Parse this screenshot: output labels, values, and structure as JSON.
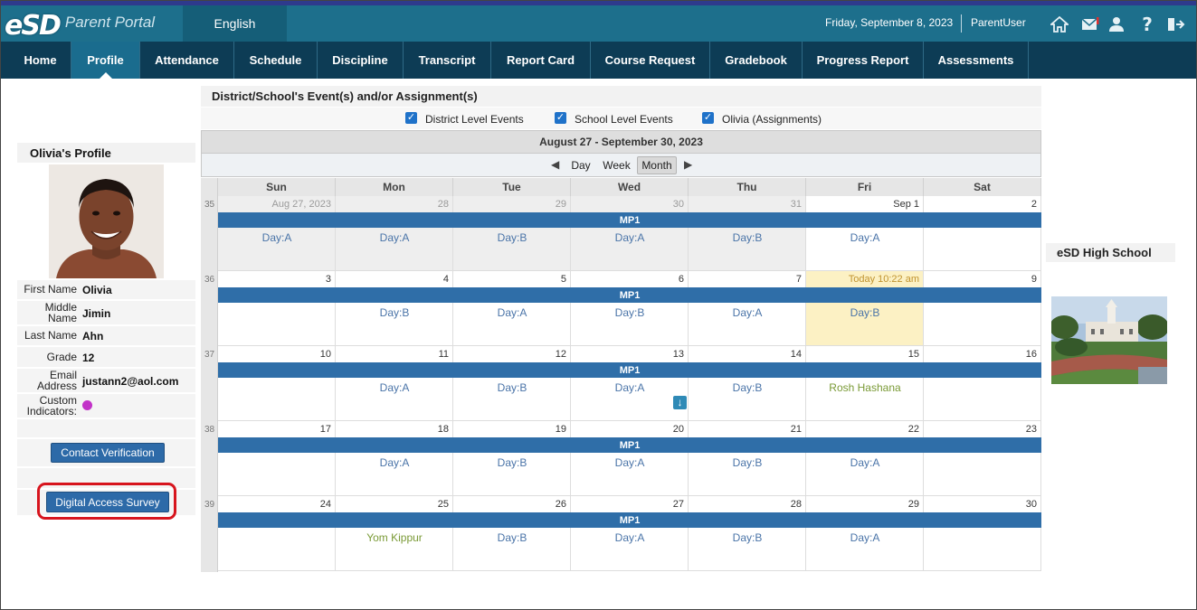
{
  "header": {
    "logo_mark": "eSD",
    "logo_text": "Parent Portal",
    "language": "English",
    "date": "Friday, September 8, 2023",
    "user": "ParentUser",
    "icons": [
      "home-icon",
      "mail-icon",
      "user-icon",
      "help-icon",
      "logout-icon"
    ]
  },
  "nav": {
    "items": [
      "Home",
      "Profile",
      "Attendance",
      "Schedule",
      "Discipline",
      "Transcript",
      "Report Card",
      "Course Request",
      "Gradebook",
      "Progress Report",
      "Assessments"
    ],
    "active": "Profile"
  },
  "profile": {
    "title": "Olivia's Profile",
    "first_name_label": "First Name",
    "first_name": "Olivia",
    "middle_name_label_1": "Middle",
    "middle_name_label_2": "Name",
    "middle_name": "Jimin",
    "last_name_label": "Last Name",
    "last_name": "Ahn",
    "grade_label": "Grade",
    "grade": "12",
    "email_label_1": "Email",
    "email_label_2": "Address",
    "email": "justann2@aol.com",
    "custom_label_1": "Custom",
    "custom_label_2": "Indicators:",
    "custom_indicator_color": "#c232c8",
    "contact_button": "Contact Verification",
    "survey_button": "Digital Access Survey"
  },
  "calendar": {
    "section_title": "District/School's Event(s) and/or Assignment(s)",
    "filters": [
      "District Level Events",
      "School Level Events",
      "Olivia (Assignments)"
    ],
    "range": "August 27 - September 30, 2023",
    "views": [
      "Day",
      "Week",
      "Month"
    ],
    "selected_view": "Month",
    "day_headers": [
      "Sun",
      "Mon",
      "Tue",
      "Wed",
      "Thu",
      "Fri",
      "Sat"
    ],
    "band_label": "MP1",
    "weeks": [
      {
        "num": "35",
        "days": [
          {
            "d": "Aug 27, 2023",
            "t": "Day:A",
            "other": true
          },
          {
            "d": "28",
            "t": "Day:A",
            "other": true
          },
          {
            "d": "29",
            "t": "Day:B",
            "other": true
          },
          {
            "d": "30",
            "t": "Day:A",
            "other": true
          },
          {
            "d": "31",
            "t": "Day:B",
            "other": true
          },
          {
            "d": "Sep 1",
            "t": "Day:A"
          },
          {
            "d": "2",
            "t": ""
          }
        ]
      },
      {
        "num": "36",
        "days": [
          {
            "d": "3",
            "t": ""
          },
          {
            "d": "4",
            "t": "Day:B"
          },
          {
            "d": "5",
            "t": "Day:A"
          },
          {
            "d": "6",
            "t": "Day:B"
          },
          {
            "d": "7",
            "t": "Day:A"
          },
          {
            "d": "Today 10:22 am",
            "t": "Day:B",
            "today": true
          },
          {
            "d": "9",
            "t": ""
          }
        ]
      },
      {
        "num": "37",
        "days": [
          {
            "d": "10",
            "t": ""
          },
          {
            "d": "11",
            "t": "Day:A"
          },
          {
            "d": "12",
            "t": "Day:B"
          },
          {
            "d": "13",
            "t": "Day:A",
            "more": true
          },
          {
            "d": "14",
            "t": "Day:B"
          },
          {
            "d": "15",
            "t": "Rosh Hashana",
            "event": true
          },
          {
            "d": "16",
            "t": ""
          }
        ]
      },
      {
        "num": "38",
        "days": [
          {
            "d": "17",
            "t": ""
          },
          {
            "d": "18",
            "t": "Day:A"
          },
          {
            "d": "19",
            "t": "Day:B"
          },
          {
            "d": "20",
            "t": "Day:A"
          },
          {
            "d": "21",
            "t": "Day:B"
          },
          {
            "d": "22",
            "t": "Day:A"
          },
          {
            "d": "23",
            "t": ""
          }
        ]
      },
      {
        "num": "39",
        "days": [
          {
            "d": "24",
            "t": ""
          },
          {
            "d": "25",
            "t": "Yom Kippur",
            "event": true
          },
          {
            "d": "26",
            "t": "Day:B"
          },
          {
            "d": "27",
            "t": "Day:A"
          },
          {
            "d": "28",
            "t": "Day:B"
          },
          {
            "d": "29",
            "t": "Day:A"
          },
          {
            "d": "30",
            "t": ""
          }
        ]
      }
    ]
  },
  "school": {
    "title": "eSD High School"
  }
}
